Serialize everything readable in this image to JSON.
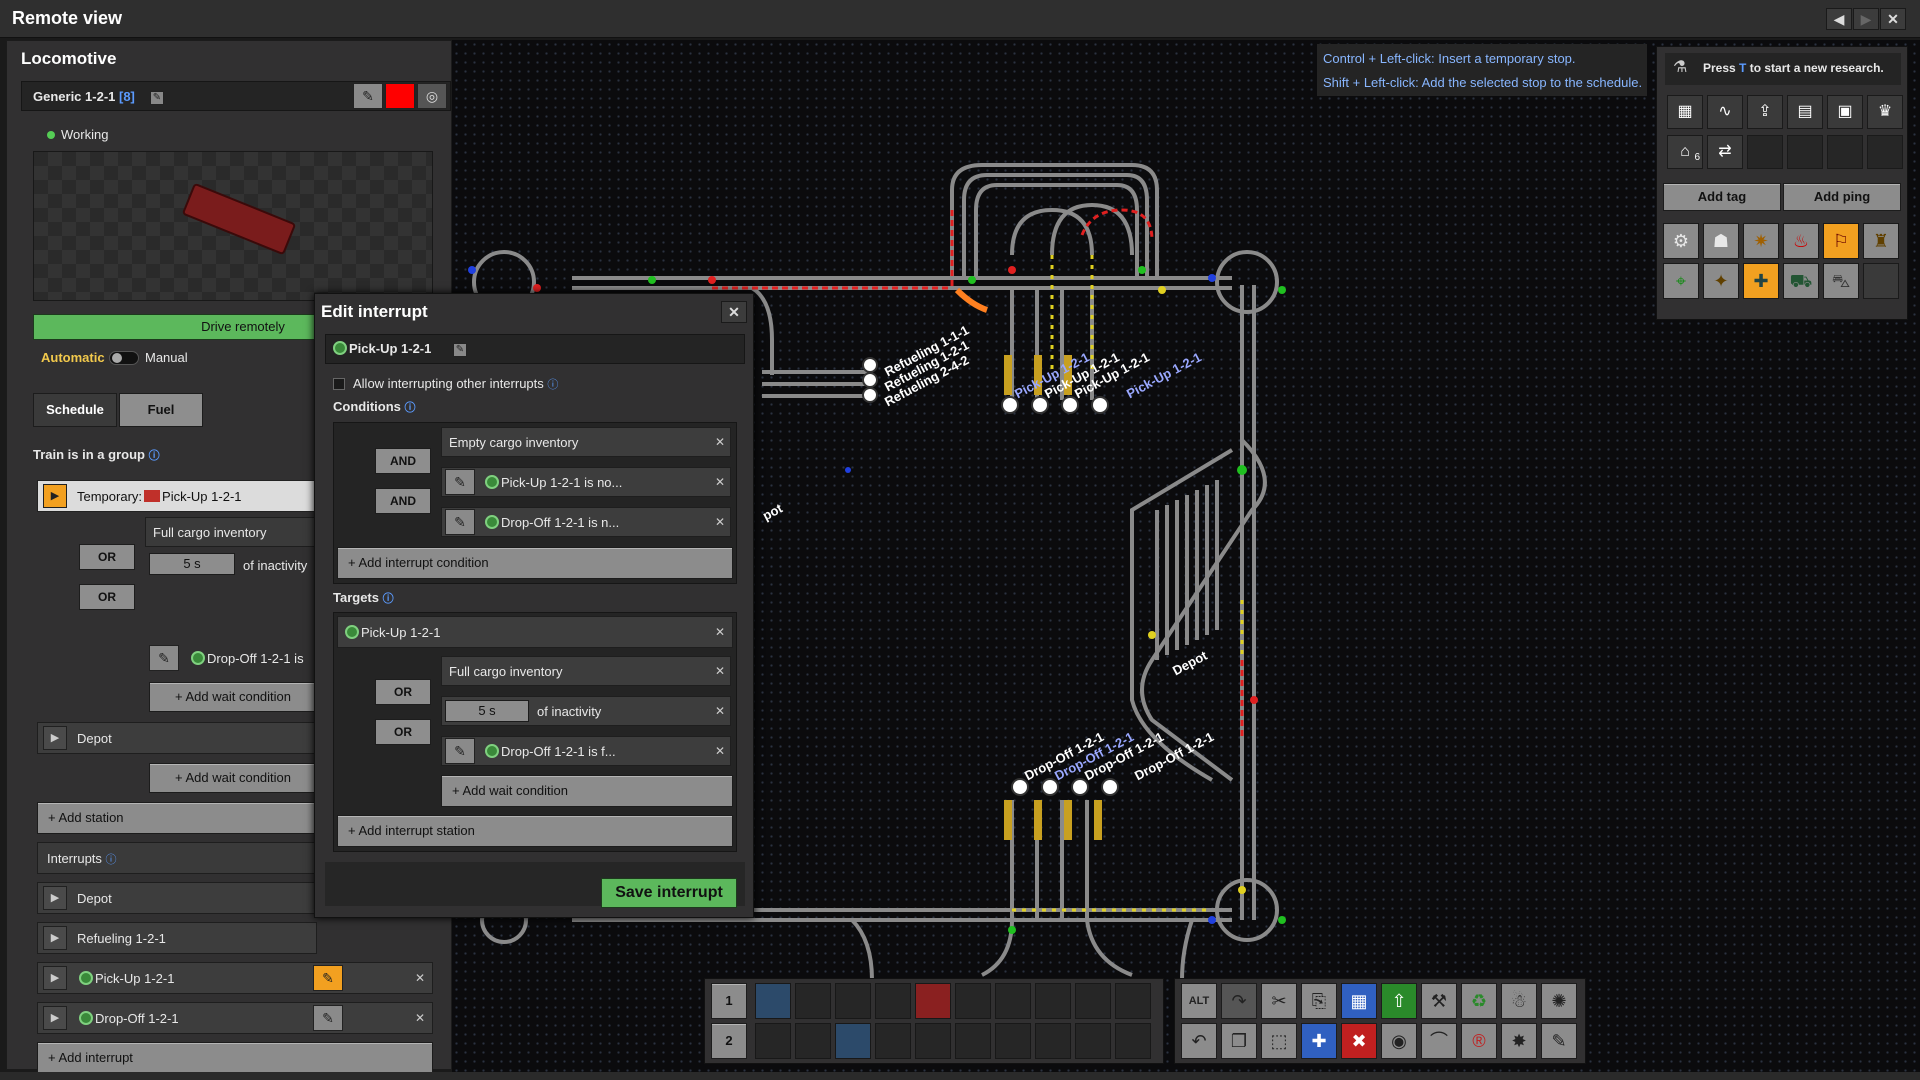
{
  "window": {
    "title": "Remote view"
  },
  "locomotive": {
    "header": "Locomotive",
    "name": "Generic 1-2-1",
    "group_count": "[8]",
    "status": "Working",
    "drive_remotely": "Drive remotely",
    "mode_automatic": "Automatic",
    "mode_manual": "Manual",
    "tabs": [
      "Schedule",
      "Fuel"
    ],
    "group_notice": "Train is in a group",
    "schedule": {
      "temp_prefix": "Temporary:",
      "temp_station": "Pick-Up 1-2-1",
      "conditions": [
        {
          "text": "Full cargo inventory"
        },
        {
          "op": "OR",
          "value": "5 s",
          "text": "of inactivity"
        },
        {
          "op": "OR",
          "text": "Drop-Off 1-2-1 is"
        }
      ],
      "add_wait": "+ Add wait condition",
      "depot": "Depot",
      "add_station": "+ Add station"
    },
    "interrupts": {
      "label": "Interrupts",
      "items": [
        "Depot",
        "Refueling 1-2-1",
        "Pick-Up 1-2-1",
        "Drop-Off 1-2-1"
      ],
      "add": "+ Add interrupt"
    }
  },
  "dialog": {
    "title": "Edit interrupt",
    "name": "Pick-Up 1-2-1",
    "allow": "Allow interrupting other interrupts",
    "conditions_label": "Conditions",
    "conditions": [
      {
        "text": "Empty cargo inventory"
      },
      {
        "op": "AND",
        "text": "Pick-Up 1-2-1 is no..."
      },
      {
        "op": "AND",
        "text": "Drop-Off 1-2-1 is n..."
      }
    ],
    "add_condition": "+ Add interrupt condition",
    "targets_label": "Targets",
    "target_station": "Pick-Up 1-2-1",
    "target_conditions": [
      {
        "text": "Full cargo inventory"
      },
      {
        "op": "OR",
        "value": "5 s",
        "text": "of inactivity"
      },
      {
        "op": "OR",
        "text": "Drop-Off 1-2-1 is f..."
      }
    ],
    "add_wait": "+ Add wait condition",
    "add_station": "+ Add interrupt station",
    "save": "Save interrupt"
  },
  "hints": {
    "line1_key": "Control + Left-click:",
    "line1_text": " Insert a temporary stop.",
    "line2_key": "Shift + Left-click:",
    "line2_text": " Add the selected stop to the schedule."
  },
  "research": {
    "prompt_pre": "Press ",
    "prompt_key": "T",
    "prompt_post": " to start a new research.",
    "add_tag": "Add tag",
    "add_ping": "Add ping",
    "badge": "6"
  },
  "map_labels": {
    "refuel": [
      "Refueling 1-1-1",
      "Refueling 1-2-1",
      "Refueling 2-4-2"
    ],
    "pickup": [
      "Pick-Up 1-2-1",
      "Pick-Up 1-2-1",
      "Pick-Up 1-2-1",
      "Pick-Up 1-2-1"
    ],
    "dropoff": [
      "Drop-Off 1-2-1",
      "Drop-Off 1-2-1",
      "Drop-Off 1-2-1",
      "Drop-Off 1-2-1"
    ],
    "depot": "Depot",
    "depot_frag": "pot"
  },
  "quickbar": {
    "rows": [
      "1",
      "2"
    ]
  },
  "colors": {
    "accent_green": "#5cb85c",
    "rail": "#8a8a8a",
    "signal_red": "#e02020",
    "signal_green": "#20c020",
    "signal_yellow": "#e0d020",
    "signal_blue": "#2040e0"
  }
}
